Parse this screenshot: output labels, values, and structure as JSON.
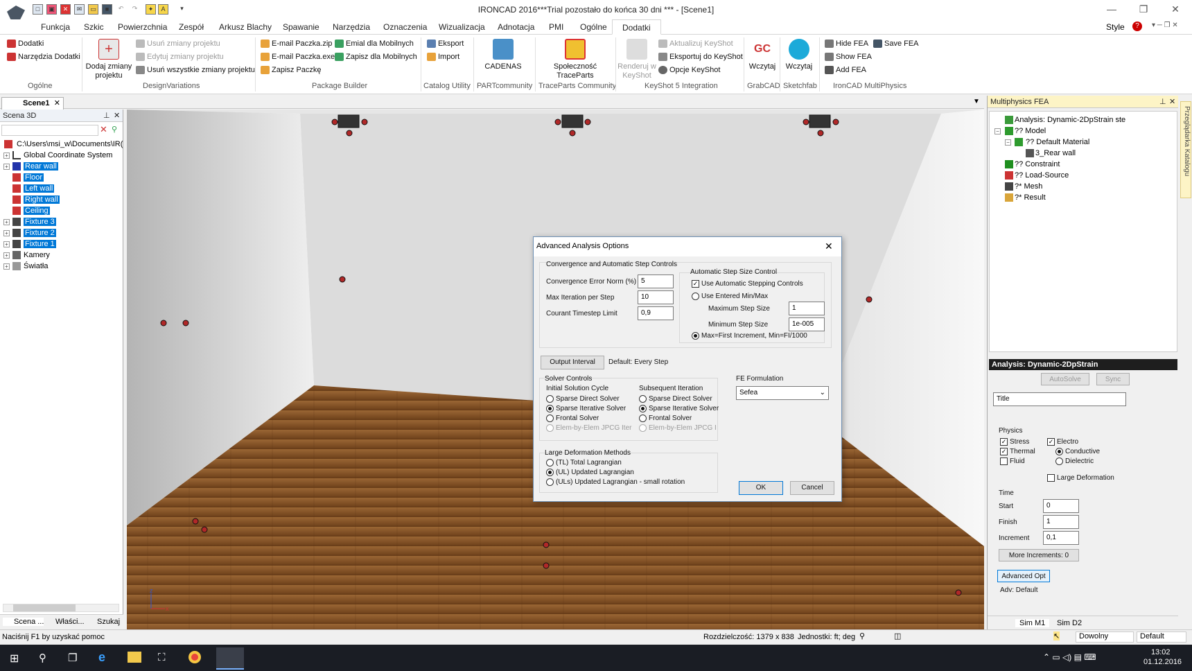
{
  "app": {
    "title": "IRONCAD 2016***Trial pozostało do końca 30 dni *** - [Scene1]",
    "style_label": "Style"
  },
  "menu": {
    "tabs": [
      "Funkcja",
      "Szkic",
      "Powierzchnia",
      "Zespół",
      "Arkusz Blachy",
      "Spawanie",
      "Narzędzia",
      "Oznaczenia",
      "Wizualizacja",
      "Adnotacja",
      "PMI",
      "Ogólne",
      "Dodatki"
    ],
    "active": "Dodatki"
  },
  "ribbon": {
    "ogolne": {
      "dodatki": "Dodatki",
      "narzedzia": "Narzędzia Dodatki",
      "group": "Ogólne"
    },
    "dv": {
      "dodaj": "Dodaj zmiany projektu",
      "usun": "Usuń zmiany projektu",
      "edytuj": "Edytuj zmiany projektu",
      "usun_all": "Usuń wszystkie zmiany projektu",
      "group": "DesignVariations"
    },
    "pb": {
      "email_zip": "E-mail Paczka.zip",
      "email_exe": "E-mail Paczka.exe",
      "zapisz": "Zapisz Paczkę",
      "emial_mob": "Emial dla Mobilnych",
      "zapisz_mob": "Zapisz dla Mobilnych",
      "group": "Package Builder"
    },
    "cu": {
      "eksport": "Eksport",
      "import": "Import",
      "group": "Catalog Utility"
    },
    "part": {
      "cadenas": "CADENAS",
      "group": "PARTcommunity"
    },
    "tp": {
      "spol": "Społeczność TraceParts",
      "group": "TraceParts Community"
    },
    "ks": {
      "renderuj": "Renderuj w KeyShot",
      "aktualizuj": "Aktualizuj KeyShot",
      "eksportuj": "Eksportuj do KeyShot",
      "opcje": "Opcje KeyShot",
      "group": "KeyShot 5 Integration"
    },
    "gc": {
      "wczytaj": "Wczytaj",
      "group": "GrabCAD"
    },
    "sf": {
      "wczytaj": "Wczytaj",
      "group": "Sketchfab"
    },
    "mp": {
      "hide": "Hide FEA",
      "save": "Save FEA",
      "show": "Show FEA",
      "add": "Add FEA",
      "group": "IronCAD MultiPhysics"
    }
  },
  "doc": {
    "tab": "Scene1"
  },
  "scene_panel": {
    "title": "Scena 3D",
    "root": "C:\\Users\\msi_w\\Documents\\IR(",
    "items": [
      "Global Coordinate System",
      "Rear wall",
      "Floor",
      "Left wall",
      "Right wall",
      "Ceiling",
      "Fixture 3",
      "Fixture 2",
      "Fixture 1",
      "Kamery",
      "Światła"
    ],
    "tabs": [
      "Scena ...",
      "Właści...",
      "Szukaj"
    ]
  },
  "fea_panel": {
    "title": "Multiphysics FEA",
    "tree": [
      "Analysis: Dynamic-2DpStrain ste",
      "?? Model",
      "?? Default Material",
      "3_Rear wall",
      "?? Constraint",
      "?? Load-Source",
      "?* Mesh",
      "?* Result"
    ],
    "catalog": "Przeglądarka Katalogu"
  },
  "analysis": {
    "header": "Analysis: Dynamic-2DpStrain",
    "autosolve": "AutoSolve",
    "sync": "Sync",
    "title_value": "Title",
    "physics_label": "Physics",
    "stress": "Stress",
    "thermal": "Thermal",
    "fluid": "Fluid",
    "electro": "Electro",
    "conductive": "Conductive",
    "dielectric": "Dielectric",
    "large_def": "Large Deformation",
    "time_label": "Time",
    "start_label": "Start",
    "start": "0",
    "finish_label": "Finish",
    "finish": "1",
    "increment_label": "Increment",
    "increment": "0,1",
    "more": "More Increments: 0",
    "advanced": "Advanced Opt",
    "adv_default": "Adv: Default",
    "sim_tabs": [
      "Sim M1",
      "Sim D2"
    ]
  },
  "dialog": {
    "title": "Advanced Analysis Options",
    "conv_group": "Convergence and Automatic Step Controls",
    "conv_err_label": "Convergence Error Norm (%)",
    "conv_err": "5",
    "max_iter_label": "Max Iteration per Step",
    "max_iter": "10",
    "courant_label": "Courant Timestep Limit",
    "courant": "0,9",
    "auto_group": "Automatic Step Size Control",
    "use_auto": "Use Automatic Stepping Controls",
    "use_entered": "Use Entered Min/Max",
    "max_step_label": "Maximum Step Size",
    "max_step": "1",
    "min_step_label": "Minimum Step Size",
    "min_step": "1e-005",
    "max_first": "Max=First Increment, Min=FI/1000",
    "output_btn": "Output Interval",
    "output_default": "Default: Every Step",
    "solver_group": "Solver Controls",
    "initial": "Initial Solution Cycle",
    "subsequent": "Subsequent Iteration",
    "solvers": [
      "Sparse Direct Solver",
      "Sparse Iterative Solver",
      "Frontal Solver"
    ],
    "elem_init": "Elem-by-Elem JPCG Iter",
    "elem_sub": "Elem-by-Elem JPCG I",
    "fe_label": "FE Formulation",
    "fe_value": "Sefea",
    "ld_group": "Large Deformation Methods",
    "ld": [
      "(TL) Total Lagrangian",
      "(UL) Updated Lagrangian",
      "(ULs) Updated Lagrangian - small rotation"
    ],
    "ok": "OK",
    "cancel": "Cancel"
  },
  "status": {
    "help": "Naciśnij F1 by uzyskać pomoc",
    "resolution": "Rozdzielczość: 1379 x 838",
    "units": "Jednostki: ft; deg",
    "mode": "Dowolny",
    "default": "Default"
  },
  "taskbar": {
    "time": "13:02",
    "date": "01.12.2016"
  },
  "colors": {
    "accent": "#0078d7",
    "ribbon_active": "#ffffff",
    "selection": "#0078d7",
    "fea_header": "#1e1e1e"
  }
}
